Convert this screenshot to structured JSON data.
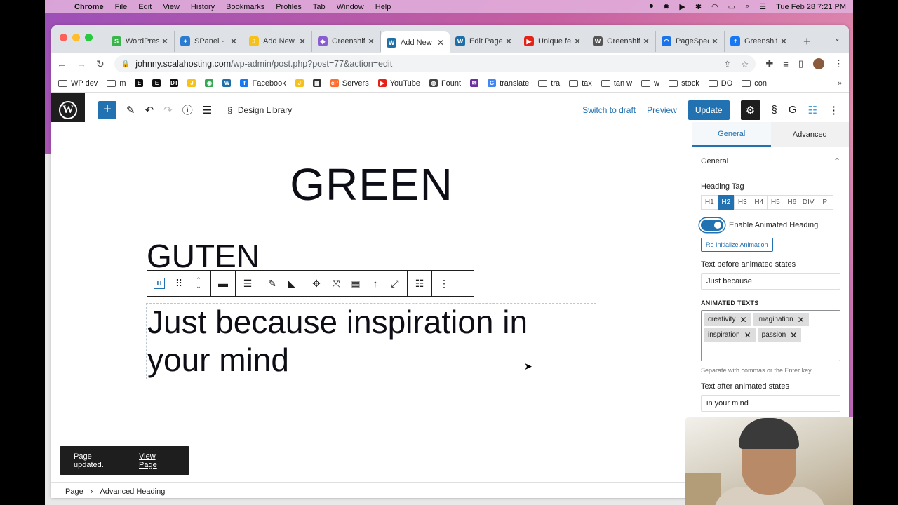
{
  "menubar": {
    "app": "Chrome",
    "items": [
      "File",
      "Edit",
      "View",
      "History",
      "Bookmarks",
      "Profiles",
      "Tab",
      "Window",
      "Help"
    ],
    "datetime": "Tue Feb 28  7:21 PM"
  },
  "tabs": [
    {
      "title": "WordPres",
      "color": "#3ab54a",
      "glyph": "S"
    },
    {
      "title": "SPanel - F",
      "color": "#2b7bd0",
      "glyph": "✦"
    },
    {
      "title": "Add New",
      "color": "#f6c11a",
      "glyph": "J"
    },
    {
      "title": "Greenshif",
      "color": "#8a5cd0",
      "glyph": "◆"
    },
    {
      "title": "Add New",
      "color": "#1e6ea7",
      "glyph": "W",
      "active": true
    },
    {
      "title": "Edit Page",
      "color": "#1e6ea7",
      "glyph": "W"
    },
    {
      "title": "Unique fe",
      "color": "#e62117",
      "glyph": "▶"
    },
    {
      "title": "Greenshif",
      "color": "#555555",
      "glyph": "W"
    },
    {
      "title": "PageSpee",
      "color": "#1a73e8",
      "glyph": "◠"
    },
    {
      "title": "Greenshif",
      "color": "#1877f2",
      "glyph": "f"
    }
  ],
  "address": {
    "host": "johnny.scalahosting.com",
    "path": "/wp-admin/post.php?post=77&action=edit"
  },
  "bookmarks": [
    {
      "label": "WP dev",
      "type": "folder"
    },
    {
      "label": "m",
      "type": "folder"
    },
    {
      "label": "",
      "type": "icon",
      "glyph": "E",
      "color": "#111111"
    },
    {
      "label": "",
      "type": "icon",
      "glyph": "E",
      "color": "#111111"
    },
    {
      "label": "",
      "type": "icon",
      "glyph": "DT",
      "color": "#111111"
    },
    {
      "label": "",
      "type": "icon",
      "glyph": "J",
      "color": "#f6c11a"
    },
    {
      "label": "",
      "type": "icon",
      "glyph": "◉",
      "color": "#34a853"
    },
    {
      "label": "",
      "type": "icon",
      "glyph": "W",
      "color": "#1e6ea7"
    },
    {
      "label": "Facebook",
      "type": "icon",
      "glyph": "f",
      "color": "#1877f2"
    },
    {
      "label": "",
      "type": "icon",
      "glyph": "J",
      "color": "#f6c11a"
    },
    {
      "label": "",
      "type": "icon",
      "glyph": "▦",
      "color": "#333333"
    },
    {
      "label": "Servers",
      "type": "icon",
      "glyph": "cP",
      "color": "#ff6c2c"
    },
    {
      "label": "YouTube",
      "type": "icon",
      "glyph": "▶",
      "color": "#e62117"
    },
    {
      "label": "Fount",
      "type": "icon",
      "glyph": "◍",
      "color": "#444444"
    },
    {
      "label": "",
      "type": "icon",
      "glyph": "✉",
      "color": "#6b2fa0"
    },
    {
      "label": "translate",
      "type": "icon",
      "glyph": "G",
      "color": "#4285f4"
    },
    {
      "label": "tra",
      "type": "folder"
    },
    {
      "label": "tax",
      "type": "folder"
    },
    {
      "label": "tan w",
      "type": "folder"
    },
    {
      "label": "w",
      "type": "folder"
    },
    {
      "label": "stock",
      "type": "folder"
    },
    {
      "label": "DO",
      "type": "folder"
    },
    {
      "label": "con",
      "type": "folder"
    }
  ],
  "wp": {
    "design_library": "Design Library",
    "switch_draft": "Switch to draft",
    "preview": "Preview",
    "update": "Update"
  },
  "content": {
    "heading_green": "GREEN",
    "heading_guten": "GUTEN",
    "animated_text": "Just because inspiration in your mind"
  },
  "snackbar": {
    "message": "Page updated.",
    "link": "View Page"
  },
  "breadcrumb": [
    "Page",
    "Advanced Heading"
  ],
  "panel": {
    "tab_general": "General",
    "tab_advanced": "Advanced",
    "section_title": "General",
    "heading_tag_label": "Heading Tag",
    "heading_tags": [
      "H1",
      "H2",
      "H3",
      "H4",
      "H5",
      "H6",
      "DIV",
      "P"
    ],
    "selected_tag": "H2",
    "enable_animated_label": "Enable Animated Heading",
    "enable_animated": true,
    "reinit_button": "Re Initialize Animation",
    "text_before_label": "Text before animated states",
    "text_before_value": "Just because",
    "animated_texts_label": "ANIMATED TEXTS",
    "animated_texts": [
      "creativity",
      "imagination",
      "inspiration",
      "passion"
    ],
    "hint": "Separate with commas or the Enter key.",
    "text_after_label": "Text after animated states",
    "text_after_value": "in your mind"
  }
}
